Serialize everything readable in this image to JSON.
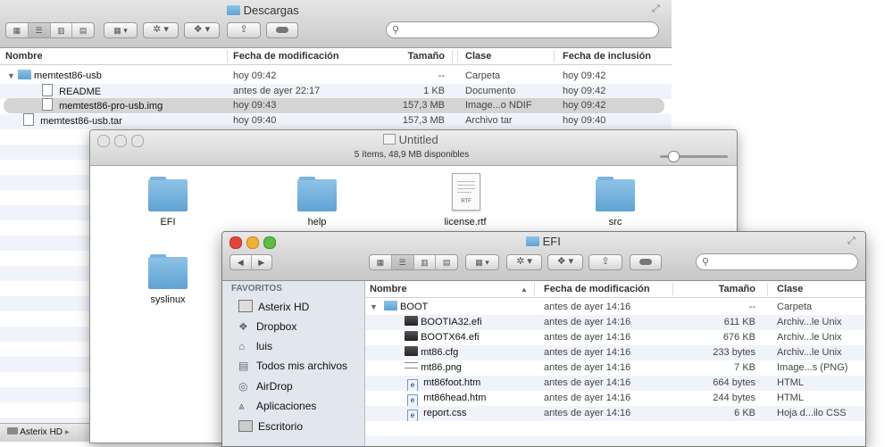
{
  "win1": {
    "title": "Descargas",
    "search_placeholder": "",
    "headers": {
      "name": "Nombre",
      "modified": "Fecha de modificación",
      "size": "Tamaño",
      "kind": "Clase",
      "added": "Fecha de inclusión"
    },
    "rows": [
      {
        "name": "memtest86-usb",
        "modified": "hoy 09:42",
        "size": "--",
        "kind": "Carpeta",
        "added": "hoy 09:42"
      },
      {
        "name": "README",
        "modified": "antes de ayer 22:17",
        "size": "1 KB",
        "kind": "Documento",
        "added": "hoy 09:42"
      },
      {
        "name": "memtest86-pro-usb.img",
        "modified": "hoy 09:43",
        "size": "157,3 MB",
        "kind": "Image...o NDIF",
        "added": "hoy 09:42"
      },
      {
        "name": "memtest86-usb.tar",
        "modified": "hoy 09:40",
        "size": "157,3 MB",
        "kind": "Archivo tar",
        "added": "hoy 09:40"
      }
    ],
    "pathbar": "Asterix HD",
    "pathbar_sep": "▸"
  },
  "win2": {
    "title": "Untitled",
    "status": "5 ítems, 48,9 MB disponibles",
    "items": [
      {
        "label": "EFI",
        "icon": "folder-icon"
      },
      {
        "label": "help",
        "icon": "folder-icon"
      },
      {
        "label": "license.rtf",
        "icon": "rtf-document-icon",
        "badge": "RTF"
      },
      {
        "label": "src",
        "icon": "folder-icon"
      },
      {
        "label": "syslinux",
        "icon": "folder-icon"
      }
    ]
  },
  "win3": {
    "title": "EFI",
    "sidebar_heading": "FAVORITOS",
    "sidebar": [
      {
        "label": "Asterix HD",
        "icon": "hard-drive-icon"
      },
      {
        "label": "Dropbox",
        "icon": "dropbox-icon"
      },
      {
        "label": "luis",
        "icon": "home-icon"
      },
      {
        "label": "Todos mis archivos",
        "icon": "all-files-icon"
      },
      {
        "label": "AirDrop",
        "icon": "airdrop-icon"
      },
      {
        "label": "Aplicaciones",
        "icon": "applications-icon"
      },
      {
        "label": "Escritorio",
        "icon": "desktop-icon"
      }
    ],
    "headers": {
      "name": "Nombre",
      "sort": "▲",
      "modified": "Fecha de modificación",
      "size": "Tamaño",
      "kind": "Clase"
    },
    "rows": [
      {
        "name": "BOOT",
        "modified": "antes de ayer 14:16",
        "size": "--",
        "kind": "Carpeta",
        "type": "folder"
      },
      {
        "name": "BOOTIA32.efi",
        "modified": "antes de ayer 14:16",
        "size": "611 KB",
        "kind": "Archiv...le Unix",
        "type": "exec"
      },
      {
        "name": "BOOTX64.efi",
        "modified": "antes de ayer 14:16",
        "size": "676 KB",
        "kind": "Archiv...le Unix",
        "type": "exec"
      },
      {
        "name": "mt86.cfg",
        "modified": "antes de ayer 14:16",
        "size": "233 bytes",
        "kind": "Archiv...le Unix",
        "type": "exec"
      },
      {
        "name": "mt86.png",
        "modified": "antes de ayer 14:16",
        "size": "7 KB",
        "kind": "Image...s (PNG)",
        "type": "image"
      },
      {
        "name": "mt86foot.htm",
        "modified": "antes de ayer 14:16",
        "size": "664 bytes",
        "kind": "HTML",
        "type": "html"
      },
      {
        "name": "mt86head.htm",
        "modified": "antes de ayer 14:16",
        "size": "244 bytes",
        "kind": "HTML",
        "type": "html"
      },
      {
        "name": "report.css",
        "modified": "antes de ayer 14:16",
        "size": "6 KB",
        "kind": "Hoja d...ilo CSS",
        "type": "html"
      }
    ]
  },
  "colors": {
    "selection": "#d4d4d4",
    "zebra": "#f0f4fa",
    "sidebar": "#e2e7ed",
    "close": "#e0463c",
    "minimize": "#f0b032",
    "zoom": "#5fbb44"
  }
}
